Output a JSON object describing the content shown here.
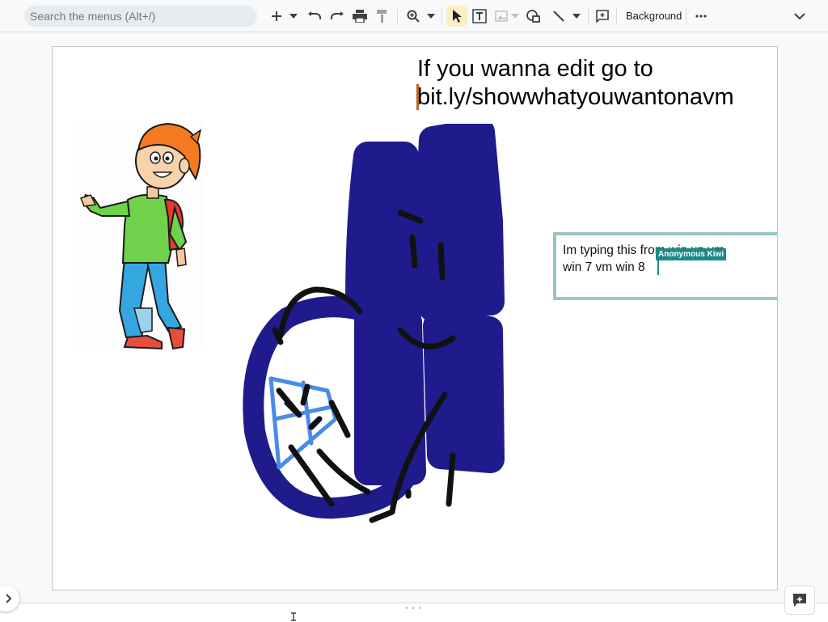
{
  "toolbar": {
    "search_placeholder": "Search the menus (Alt+/)",
    "background_label": "Background",
    "icons": [
      "plus-icon",
      "dropdown-icon",
      "undo-icon",
      "redo-icon",
      "print-icon",
      "paint-format-icon",
      "zoom-icon",
      "dropdown-icon",
      "select-cursor-icon",
      "textbox-icon",
      "image-icon",
      "shape-icon",
      "line-icon",
      "comment-icon",
      "more-icon",
      "collapse-chevron-icon"
    ]
  },
  "slide": {
    "title_line1": "If you wanna edit go to",
    "title_line2": "bit.ly/showwhatyouwantonavm",
    "textbox_line1": "Im typing this from win xp vm",
    "textbox_line2": "win 7 vm win 8",
    "collaborator_name": "Anonymous Kiwi",
    "collaborator_color": "#1a8a86",
    "drawing_fill_color": "#1f1b8c",
    "drawing_accent_color": "#4a8be8"
  },
  "colors": {
    "selected_tool_bg": "#fdefc3",
    "textbox_border": "#98c5c7"
  }
}
